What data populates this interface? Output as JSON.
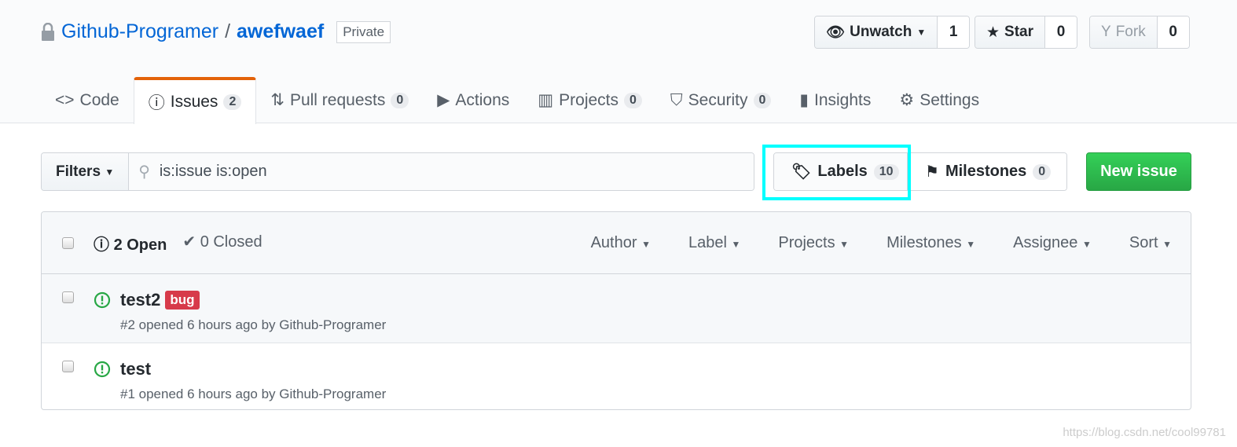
{
  "repo": {
    "owner": "Github-Programer",
    "separator": "/",
    "name": "awefwaef",
    "visibility": "Private"
  },
  "actions": {
    "watch_label": "Unwatch",
    "watch_count": "1",
    "star_label": "Star",
    "star_count": "0",
    "fork_label": "Fork",
    "fork_count": "0"
  },
  "tabs": [
    {
      "label": "Code"
    },
    {
      "label": "Issues",
      "count": "2"
    },
    {
      "label": "Pull requests",
      "count": "0"
    },
    {
      "label": "Actions"
    },
    {
      "label": "Projects",
      "count": "0"
    },
    {
      "label": "Security",
      "count": "0"
    },
    {
      "label": "Insights"
    },
    {
      "label": "Settings"
    }
  ],
  "filters": {
    "label": "Filters",
    "query": "is:issue is:open"
  },
  "labels": {
    "label": "Labels",
    "count": "10"
  },
  "milestones": {
    "label": "Milestones",
    "count": "0"
  },
  "new_issue": "New issue",
  "list": {
    "open": "2 Open",
    "closed": "0 Closed",
    "dropdowns": [
      "Author",
      "Label",
      "Projects",
      "Milestones",
      "Assignee",
      "Sort"
    ]
  },
  "issues": [
    {
      "title": "test2",
      "label": "bug",
      "label_color": "#d73a4a",
      "meta": "#2 opened 6 hours ago by Github-Programer"
    },
    {
      "title": "test",
      "meta": "#1 opened 6 hours ago by Github-Programer"
    }
  ],
  "watermark": "https://blog.csdn.net/cool99781",
  "colors": {
    "accent": "#e36209",
    "link": "#0366d6",
    "open": "#28a745",
    "highlight": "#00ffff"
  }
}
